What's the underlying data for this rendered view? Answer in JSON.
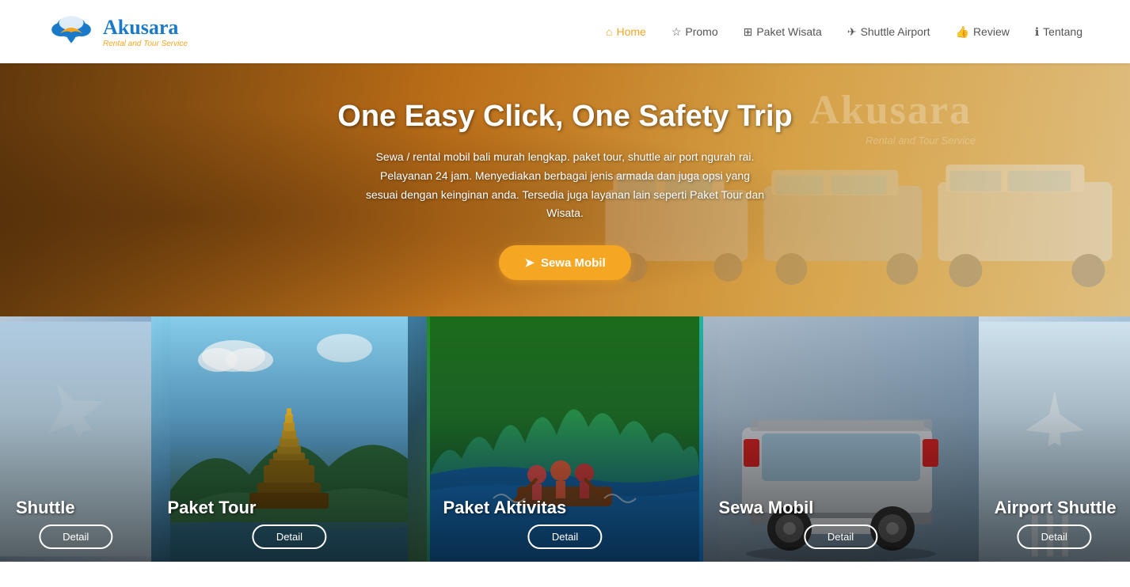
{
  "logo": {
    "title": "Akusara",
    "subtitle": "Rental and Tour Service"
  },
  "nav": {
    "links": [
      {
        "id": "home",
        "label": "Home",
        "icon": "home-icon",
        "active": true
      },
      {
        "id": "promo",
        "label": "Promo",
        "icon": "star-icon",
        "active": false
      },
      {
        "id": "paket-wisata",
        "label": "Paket Wisata",
        "icon": "grid-icon",
        "active": false
      },
      {
        "id": "shuttle-airport",
        "label": "Shuttle Airport",
        "icon": "plane-nav-icon",
        "active": false
      },
      {
        "id": "review",
        "label": "Review",
        "icon": "thumb-icon",
        "active": false
      },
      {
        "id": "tentang",
        "label": "Tentang",
        "icon": "info-icon",
        "active": false
      }
    ]
  },
  "hero": {
    "title": "One Easy Click, One Safety Trip",
    "description": "Sewa / rental mobil bali murah lengkap. paket tour, shuttle air port ngurah rai.\nPelayanan 24 jam. Menyediakan berbagai jenis armada dan juga opsi yang\nsesuai dengan keinginan anda. Tersedia juga layanan lain seperti Paket Tour dan\nWisata.",
    "cta_label": "Sewa Mobil",
    "watermark": "Akusara",
    "watermark_sub": "Rental and Tour Service"
  },
  "cards": [
    {
      "id": "shuttle",
      "label": "Shuttle",
      "btn_label": "Detail",
      "type": "shuttle"
    },
    {
      "id": "paket-tour",
      "label": "Paket Tour",
      "btn_label": "Detail",
      "type": "tour"
    },
    {
      "id": "paket-aktivitas",
      "label": "Paket Aktivitas",
      "btn_label": "Detail",
      "type": "aktivitas"
    },
    {
      "id": "sewa-mobil",
      "label": "Sewa Mobil",
      "btn_label": "Detail",
      "type": "sewa"
    },
    {
      "id": "airport-shuttle",
      "label": "Airport Shuttle",
      "btn_label": "Detail",
      "type": "airport"
    }
  ],
  "colors": {
    "accent": "#f5a623",
    "nav_active": "#f5a623",
    "brand_blue": "#1a7ac9",
    "hero_btn": "#f5a623"
  }
}
